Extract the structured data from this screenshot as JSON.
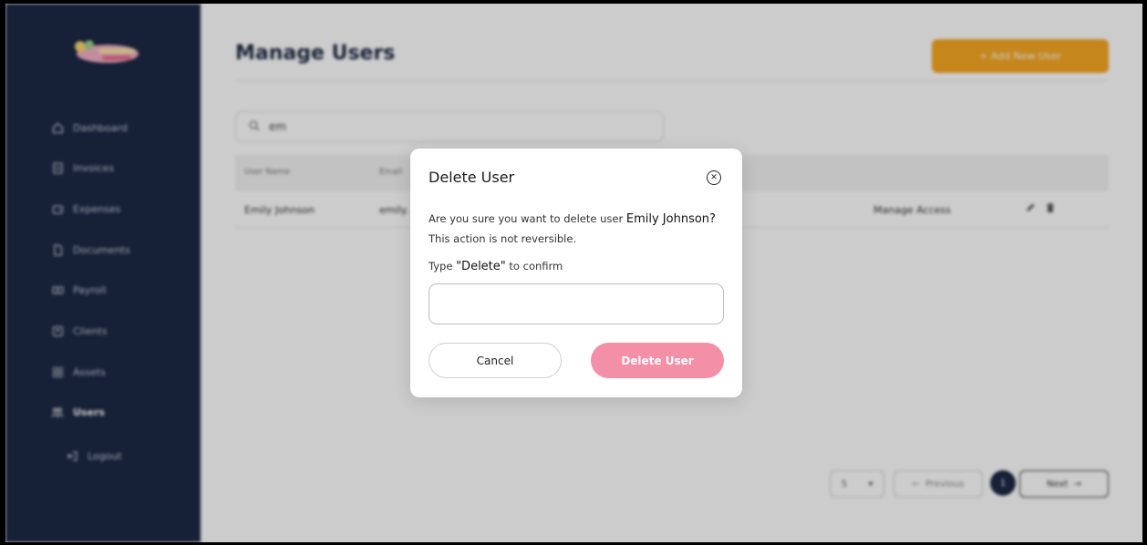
{
  "sidebar": {
    "logo_alt": "app-logo",
    "items": [
      {
        "label": "Dashboard",
        "icon": "home-icon",
        "active": false
      },
      {
        "label": "Invoices",
        "icon": "invoice-icon",
        "active": false
      },
      {
        "label": "Expenses",
        "icon": "wallet-icon",
        "active": false
      },
      {
        "label": "Documents",
        "icon": "document-icon",
        "active": false
      },
      {
        "label": "Payroll",
        "icon": "payroll-icon",
        "active": false
      },
      {
        "label": "Clients",
        "icon": "clients-icon",
        "active": false
      },
      {
        "label": "Assets",
        "icon": "assets-icon",
        "active": false
      },
      {
        "label": "Users",
        "icon": "users-icon",
        "active": true
      },
      {
        "label": "Logout",
        "icon": "logout-icon",
        "active": false
      }
    ]
  },
  "main": {
    "title": "Manage Users",
    "add_button": "+ Add New User",
    "search_value": "em",
    "table": {
      "headers": [
        "User Name",
        "Email"
      ],
      "rows": [
        {
          "name": "Emily Johnson",
          "email": "emily.",
          "access": "Manage Access"
        }
      ]
    },
    "pagination": {
      "page_size": "5",
      "prev_label": "Previous",
      "current_page": "1",
      "next_label": "Next"
    }
  },
  "modal": {
    "title": "Delete User",
    "message_prefix": "Are you sure you want to delete user",
    "user_name": "Emily Johnson?",
    "message_line2": "This action is not reversible.",
    "confirm_prefix": "Type",
    "confirm_keyword": "\"Delete\"",
    "confirm_suffix": "to confirm",
    "input_value": "",
    "cancel_label": "Cancel",
    "delete_label": "Delete User"
  },
  "colors": {
    "sidebar": "#1c2844",
    "accent": "#f7a824",
    "danger": "#f38fa6"
  }
}
